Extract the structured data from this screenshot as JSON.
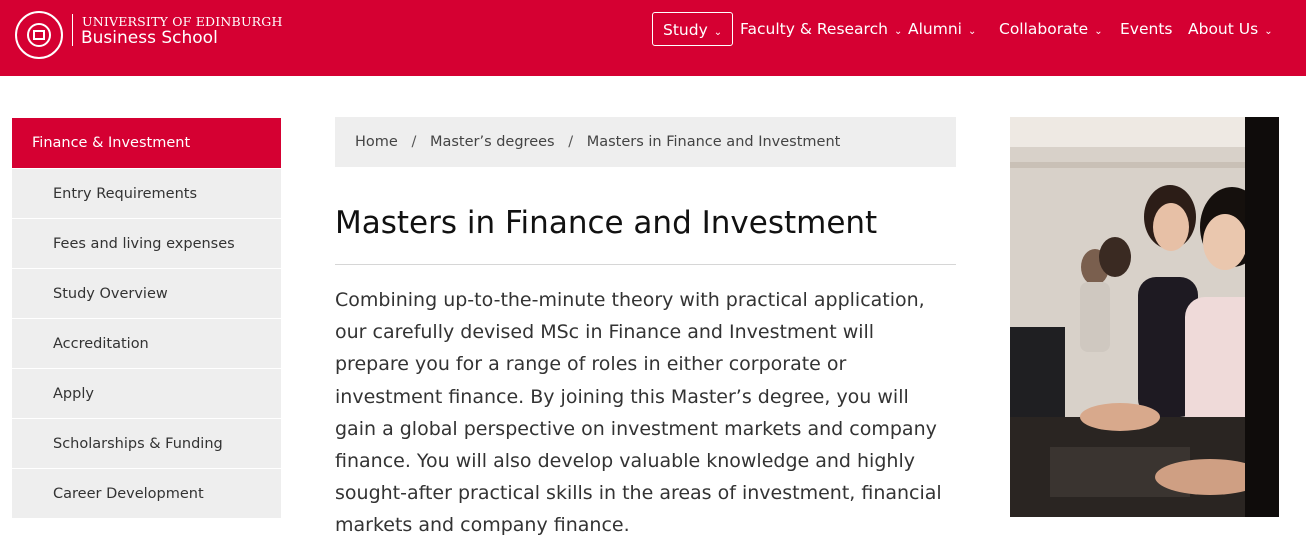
{
  "brand": {
    "line1": "UNIVERSITY OF EDINBURGH",
    "line2": "Business School",
    "seal_text": "THE UNIVERSITY of EDINBURGH",
    "color": "#d50032"
  },
  "nav": {
    "items": [
      {
        "label": "Study",
        "has_dropdown": true,
        "active": true
      },
      {
        "label": "Faculty & Research",
        "has_dropdown": true
      },
      {
        "label": "Alumni",
        "has_dropdown": true
      },
      {
        "label": "Collaborate",
        "has_dropdown": true
      },
      {
        "label": "Events",
        "has_dropdown": false
      },
      {
        "label": "About Us",
        "has_dropdown": true
      }
    ]
  },
  "sidebar": {
    "heading": "Finance & Investment",
    "items": [
      {
        "label": "Entry Requirements"
      },
      {
        "label": "Fees and living expenses"
      },
      {
        "label": "Study Overview"
      },
      {
        "label": "Accreditation"
      },
      {
        "label": "Apply"
      },
      {
        "label": "Scholarships & Funding"
      },
      {
        "label": "Career Development"
      }
    ]
  },
  "breadcrumb": {
    "items": [
      "Home",
      "Master’s degrees",
      "Masters in Finance and Investment"
    ],
    "separator": "/"
  },
  "page": {
    "title": "Masters in Finance and Investment",
    "intro": "Combining up-to-the-minute theory with practical application, our carefully devised MSc in Finance and Investment will prepare you for a range of roles in either corporate or investment finance. By joining this Master’s degree, you will gain a global perspective on investment markets and company finance. You will also develop valuable knowledge and highly sought-after practical skills in the areas of investment, financial markets and company finance."
  },
  "icons": {
    "chevron": "chevron-down-icon",
    "logo": "university-seal-icon"
  }
}
